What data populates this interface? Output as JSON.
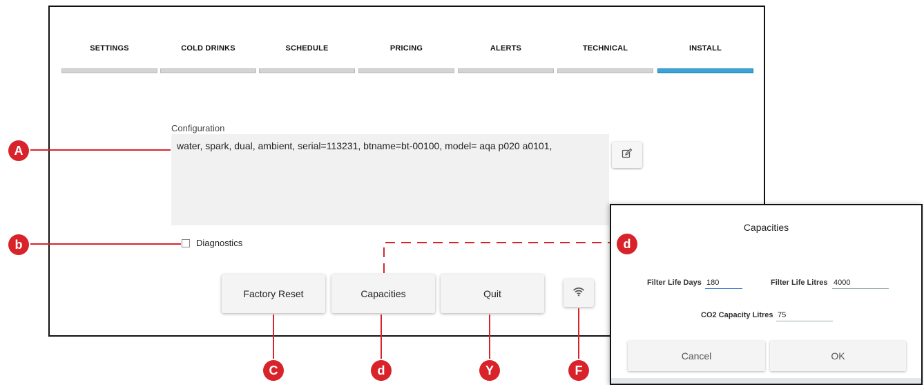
{
  "tabs": [
    {
      "label": "SETTINGS",
      "active": false
    },
    {
      "label": "COLD DRINKS",
      "active": false
    },
    {
      "label": "SCHEDULE",
      "active": false
    },
    {
      "label": "PRICING",
      "active": false
    },
    {
      "label": "ALERTS",
      "active": false
    },
    {
      "label": "TECHNICAL",
      "active": false
    },
    {
      "label": "INSTALL",
      "active": true
    }
  ],
  "configuration": {
    "label": "Configuration",
    "value": "water, spark, dual, ambient, serial=113231, btname=bt-00100, model= aqa p020 a0101,"
  },
  "diagnostics": {
    "label": "Diagnostics",
    "checked": false
  },
  "buttons": {
    "factory_reset": "Factory Reset",
    "capacities": "Capacities",
    "quit": "Quit"
  },
  "icons": {
    "edit": "edit-icon",
    "wifi": "wifi-icon"
  },
  "callouts": {
    "a": "A",
    "b": "b",
    "c": "C",
    "d_top": "d",
    "d_bottom": "d",
    "y": "Y",
    "f": "F"
  },
  "dialog": {
    "title": "Capacities",
    "filter_life_days": {
      "label": "Filter Life Days",
      "value": "180"
    },
    "filter_life_litres": {
      "label": "Filter Life Litres",
      "value": "4000"
    },
    "co2_capacity_litres": {
      "label": "CO2 Capacity Litres",
      "value": "75"
    },
    "cancel_label": "Cancel",
    "ok_label": "OK"
  },
  "colors": {
    "accent": "#3aa3d8",
    "callout": "#d8232a"
  }
}
